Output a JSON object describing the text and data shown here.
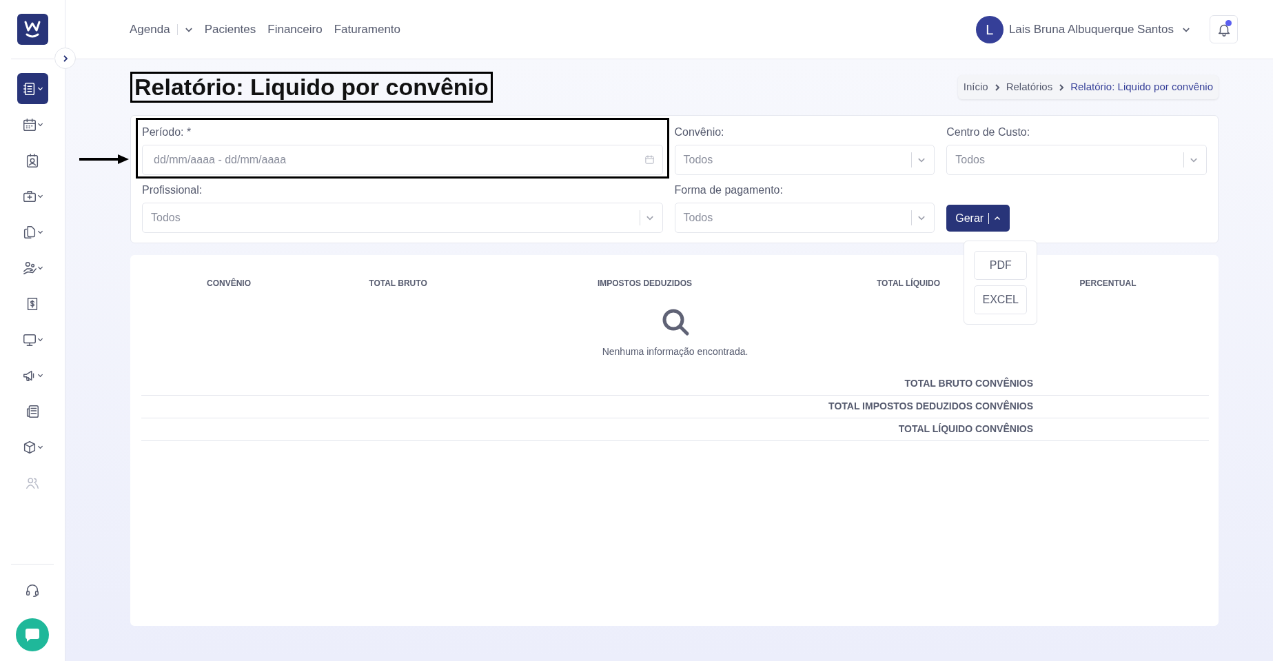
{
  "nav": {
    "items": [
      {
        "label": "Agenda",
        "dropdown": true
      },
      {
        "label": "Pacientes",
        "dropdown": false
      },
      {
        "label": "Financeiro",
        "dropdown": false
      },
      {
        "label": "Faturamento",
        "dropdown": false
      }
    ]
  },
  "user": {
    "initial": "L",
    "name": "Lais Bruna Albuquerque Santos"
  },
  "notifications": {
    "unread": true
  },
  "sidebar": {
    "items": [
      {
        "selected": true,
        "dropdown": true,
        "disabled": false
      },
      {
        "selected": false,
        "dropdown": true,
        "disabled": false
      },
      {
        "selected": false,
        "dropdown": false,
        "disabled": false
      },
      {
        "selected": false,
        "dropdown": true,
        "disabled": false
      },
      {
        "selected": false,
        "dropdown": true,
        "disabled": false
      },
      {
        "selected": false,
        "dropdown": true,
        "disabled": false
      },
      {
        "selected": false,
        "dropdown": false,
        "disabled": false
      },
      {
        "selected": false,
        "dropdown": true,
        "disabled": false
      },
      {
        "selected": false,
        "dropdown": true,
        "disabled": false
      },
      {
        "selected": false,
        "dropdown": false,
        "disabled": false
      },
      {
        "selected": false,
        "dropdown": true,
        "disabled": false
      },
      {
        "selected": false,
        "dropdown": false,
        "disabled": true
      }
    ]
  },
  "page": {
    "title": "Relatório: Liquido por convênio",
    "title_highlighted": true,
    "breadcrumb": [
      {
        "label": "Início",
        "current": false
      },
      {
        "label": "Relatórios",
        "current": false
      },
      {
        "label": "Relatório: Liquido por convênio",
        "current": true
      }
    ]
  },
  "filters": [
    {
      "kind": "daterange",
      "label": "Período: *",
      "placeholder": "dd/mm/aaaa - dd/mm/aaaa",
      "highlighted": true
    },
    {
      "kind": "select",
      "label": "Convênio:",
      "value": "Todos",
      "highlighted": false
    },
    {
      "kind": "select",
      "label": "Centro de Custo:",
      "value": "Todos",
      "highlighted": false
    },
    {
      "kind": "select",
      "label": "Profissional:",
      "value": "Todos",
      "highlighted": false
    },
    {
      "kind": "select",
      "label": "Forma de pagamento:",
      "value": "Todos",
      "highlighted": false
    }
  ],
  "generate": {
    "label": "Gerar",
    "expanded": true,
    "options": [
      "PDF",
      "EXCEL"
    ]
  },
  "table": {
    "columns": [
      "CONVÊNIO",
      "TOTAL BRUTO",
      "IMPOSTOS DEDUZIDOS",
      "TOTAL LÍQUIDO",
      "PERCENTUAL"
    ],
    "empty_message": "Nenhuma informação encontrada.",
    "totals": [
      "TOTAL BRUTO CONVÊNIOS",
      "TOTAL IMPOSTOS DEDUZIDOS CONVÊNIOS",
      "TOTAL LÍQUIDO CONVÊNIOS"
    ]
  }
}
